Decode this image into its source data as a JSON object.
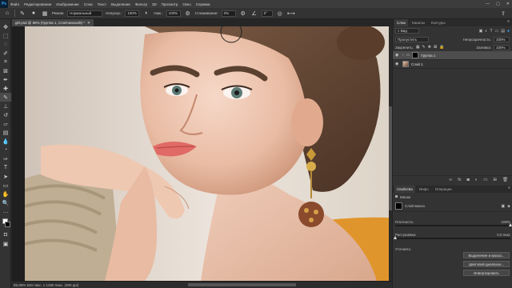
{
  "app": {
    "logo": "Ps"
  },
  "menu": [
    "Файл",
    "Редактирование",
    "Изображение",
    "Слои",
    "Текст",
    "Выделение",
    "Фильтр",
    "3D",
    "Просмотр",
    "Окно",
    "Справка"
  ],
  "window_controls": {
    "minimize": "—",
    "maximize": "▢",
    "close": "✕"
  },
  "options": {
    "mode_label": "Режим:",
    "mode_value": "Нормальный",
    "opacity_label": "Непрозр.:",
    "opacity_value": "100%",
    "pressure_label": "Наж.:",
    "pressure_value": "100%",
    "smoothing_label": "Сглаживание:",
    "smoothing_value": "0%",
    "angle_value": "0°"
  },
  "document": {
    "tab_title": "girl.psd @ 86% (Группа 1, Слой-маска/8) *",
    "close": "✕"
  },
  "status": {
    "text": "85,99% 640 пикс. x 1280 пикс. (300 ppi)"
  },
  "layers_panel": {
    "tabs": [
      "Слои",
      "Каналы",
      "Контуры"
    ],
    "kind_value": "Вид",
    "blend_value": "Пропустить",
    "opacity_label": "Непрозрачность:",
    "opacity_value": "100%",
    "lock_label": "Закрепить:",
    "fill_label": "Заливка:",
    "fill_value": "100%",
    "layers": [
      {
        "name": "Группа 1",
        "selected": true
      },
      {
        "name": "Слой 1",
        "selected": false
      }
    ],
    "footer_icons": [
      "link-icon",
      "fx-icon",
      "mask-icon",
      "adjustment-icon",
      "folder-icon",
      "new-layer-icon",
      "trash-icon"
    ]
  },
  "properties_panel": {
    "tabs": [
      "Свойства",
      "Инфо",
      "Операции"
    ],
    "section_title": "Маски",
    "mask_title": "Слой-маска",
    "density_label": "Плотность:",
    "density_value": "100%",
    "density_fraction": 1.0,
    "feather_label": "Растушевка:",
    "feather_value": "0,0 пикс",
    "feather_fraction": 0.0,
    "refine_label": "Уточнить:",
    "buttons": [
      "Выделение и маска...",
      "Цветовой диапазон...",
      "Инвертировать"
    ]
  }
}
